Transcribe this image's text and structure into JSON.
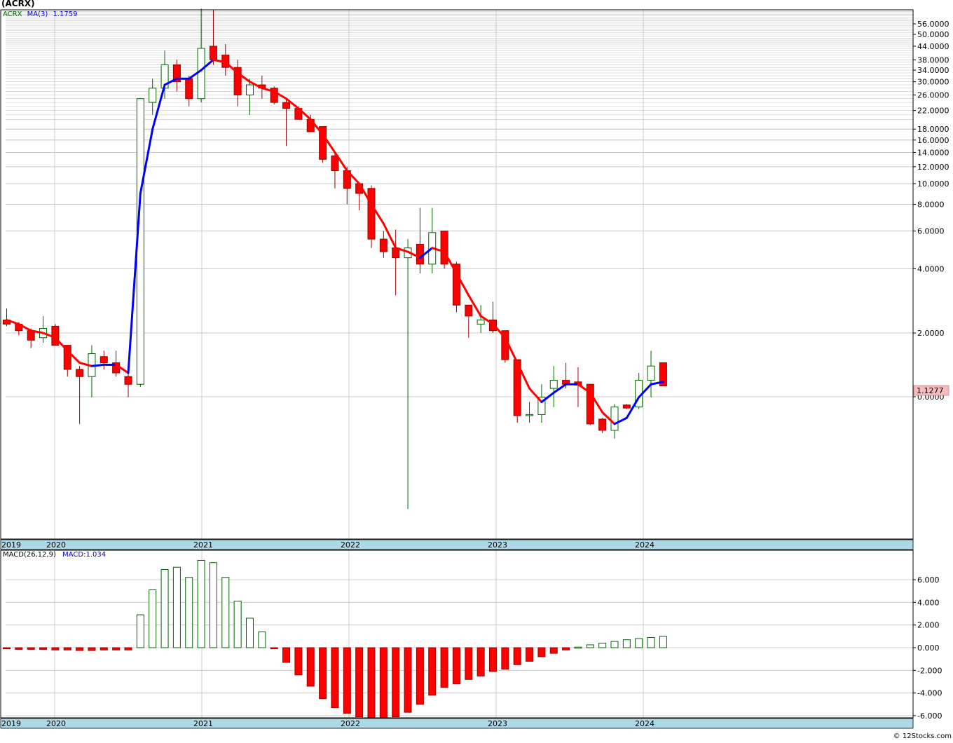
{
  "title": "(ACRX)",
  "footer": "© 12Stocks.com",
  "price_legend": {
    "symbol": "ACRX",
    "ma_label": "MA(3)",
    "ma_value": "1.1759"
  },
  "macd_legend": {
    "label": "MACD(26,12,9)",
    "value_label": "MACD:1.034"
  },
  "last_price_label": "1.1277",
  "colors": {
    "up_outline": "#006400",
    "down_fill": "#ff0000",
    "down_outline": "#990000",
    "ma_up": "#0000ff",
    "ma_down": "#ff0000",
    "grid": "#b0b0b0",
    "axis_band": "#add8e6",
    "last_price_bg": "#f4bcbc"
  },
  "chart_data": [
    {
      "type": "candlestick",
      "scale": "log",
      "y_ticks": [
        "56.0000",
        "50.0000",
        "44.0000",
        "38.0000",
        "34.0000",
        "30.0000",
        "26.0000",
        "22.0000",
        "18.0000",
        "16.0000",
        "14.0000",
        "12.0000",
        "10.0000",
        "8.0000",
        "6.0000",
        "4.0000",
        "2.0000",
        "0.0000"
      ],
      "x_labels": [
        "2019",
        "2020",
        "2021",
        "2022",
        "2023",
        "2024"
      ],
      "candles": [
        {
          "o": 2.3,
          "h": 2.6,
          "l": 2.15,
          "c": 2.2
        },
        {
          "o": 2.2,
          "h": 2.25,
          "l": 1.95,
          "c": 2.05
        },
        {
          "o": 2.05,
          "h": 2.1,
          "l": 1.7,
          "c": 1.85
        },
        {
          "o": 1.9,
          "h": 2.4,
          "l": 1.8,
          "c": 2.1
        },
        {
          "o": 2.15,
          "h": 2.2,
          "l": 1.75,
          "c": 1.75
        },
        {
          "o": 1.75,
          "h": 1.75,
          "l": 1.25,
          "c": 1.35
        },
        {
          "o": 1.35,
          "h": 1.4,
          "l": 0.75,
          "c": 1.25
        },
        {
          "o": 1.25,
          "h": 1.75,
          "l": 1.0,
          "c": 1.6
        },
        {
          "o": 1.55,
          "h": 1.65,
          "l": 1.35,
          "c": 1.45
        },
        {
          "o": 1.45,
          "h": 1.65,
          "l": 1.25,
          "c": 1.3
        },
        {
          "o": 1.25,
          "h": 1.3,
          "l": 1.0,
          "c": 1.15
        },
        {
          "o": 1.15,
          "h": 25.0,
          "l": 1.12,
          "c": 25.0
        },
        {
          "o": 24.0,
          "h": 31.0,
          "l": 21.0,
          "c": 28.0
        },
        {
          "o": 28.0,
          "h": 42.0,
          "l": 25.0,
          "c": 36.0
        },
        {
          "o": 36.0,
          "h": 38.0,
          "l": 27.0,
          "c": 30.0
        },
        {
          "o": 31.0,
          "h": 32.0,
          "l": 23.0,
          "c": 25.0
        },
        {
          "o": 25.0,
          "h": 66.0,
          "l": 24.0,
          "c": 43.0
        },
        {
          "o": 44.0,
          "h": 65.0,
          "l": 36.0,
          "c": 38.0
        },
        {
          "o": 40.0,
          "h": 45.0,
          "l": 32.0,
          "c": 35.0
        },
        {
          "o": 35.0,
          "h": 38.0,
          "l": 23.0,
          "c": 26.0
        },
        {
          "o": 26.0,
          "h": 31.0,
          "l": 21.0,
          "c": 29.0
        },
        {
          "o": 29.0,
          "h": 32.0,
          "l": 25.0,
          "c": 28.0
        },
        {
          "o": 28.0,
          "h": 28.5,
          "l": 23.5,
          "c": 24.0
        },
        {
          "o": 24.0,
          "h": 25.0,
          "l": 15.0,
          "c": 22.5
        },
        {
          "o": 22.5,
          "h": 23.0,
          "l": 20.0,
          "c": 20.0
        },
        {
          "o": 20.0,
          "h": 21.0,
          "l": 17.5,
          "c": 17.5
        },
        {
          "o": 18.5,
          "h": 18.5,
          "l": 12.5,
          "c": 13.0
        },
        {
          "o": 13.5,
          "h": 14.0,
          "l": 9.5,
          "c": 11.5
        },
        {
          "o": 11.5,
          "h": 12.0,
          "l": 8.0,
          "c": 9.5
        },
        {
          "o": 10.0,
          "h": 10.0,
          "l": 7.5,
          "c": 9.0
        },
        {
          "o": 9.5,
          "h": 9.8,
          "l": 5.0,
          "c": 5.5
        },
        {
          "o": 5.5,
          "h": 6.0,
          "l": 4.5,
          "c": 4.8
        },
        {
          "o": 5.0,
          "h": 6.1,
          "l": 3.0,
          "c": 4.5
        },
        {
          "o": 4.5,
          "h": 5.5,
          "l": 0.3,
          "c": 5.0
        },
        {
          "o": 5.2,
          "h": 7.7,
          "l": 3.8,
          "c": 4.2
        },
        {
          "o": 4.2,
          "h": 7.7,
          "l": 3.8,
          "c": 5.9
        },
        {
          "o": 6.0,
          "h": 6.0,
          "l": 4.0,
          "c": 4.2
        },
        {
          "o": 4.2,
          "h": 4.3,
          "l": 2.5,
          "c": 2.7
        },
        {
          "o": 2.7,
          "h": 2.7,
          "l": 1.9,
          "c": 2.4
        },
        {
          "o": 2.2,
          "h": 2.7,
          "l": 2.0,
          "c": 2.3
        },
        {
          "o": 2.3,
          "h": 2.8,
          "l": 2.0,
          "c": 2.05
        },
        {
          "o": 2.05,
          "h": 2.05,
          "l": 1.45,
          "c": 1.5
        },
        {
          "o": 1.5,
          "h": 1.5,
          "l": 0.76,
          "c": 0.82
        },
        {
          "o": 0.83,
          "h": 0.95,
          "l": 0.76,
          "c": 0.83
        },
        {
          "o": 0.83,
          "h": 1.15,
          "l": 0.76,
          "c": 1.0
        },
        {
          "o": 1.1,
          "h": 1.4,
          "l": 0.9,
          "c": 1.2
        },
        {
          "o": 1.2,
          "h": 1.45,
          "l": 1.1,
          "c": 1.15
        },
        {
          "o": 1.18,
          "h": 1.38,
          "l": 0.9,
          "c": 1.14
        },
        {
          "o": 1.15,
          "h": 1.15,
          "l": 0.74,
          "c": 0.75
        },
        {
          "o": 0.79,
          "h": 0.8,
          "l": 0.68,
          "c": 0.7
        },
        {
          "o": 0.7,
          "h": 0.93,
          "l": 0.64,
          "c": 0.9
        },
        {
          "o": 0.92,
          "h": 0.93,
          "l": 0.88,
          "c": 0.89
        },
        {
          "o": 0.9,
          "h": 1.3,
          "l": 0.88,
          "c": 1.2
        },
        {
          "o": 1.2,
          "h": 1.65,
          "l": 1.0,
          "c": 1.4
        },
        {
          "o": 1.45,
          "h": 1.45,
          "l": 1.15,
          "c": 1.13
        }
      ],
      "ma3": [
        2.3,
        2.2,
        2.05,
        2.0,
        1.9,
        1.65,
        1.45,
        1.4,
        1.42,
        1.42,
        1.3,
        9.0,
        18.0,
        29.0,
        31.0,
        31.0,
        34.0,
        38.0,
        37.0,
        33.0,
        30.0,
        28.0,
        27.0,
        25.0,
        22.5,
        20.0,
        17.0,
        14.0,
        11.5,
        10.0,
        8.0,
        6.5,
        5.0,
        4.8,
        4.5,
        5.0,
        4.8,
        3.8,
        3.0,
        2.4,
        2.2,
        1.9,
        1.45,
        1.1,
        0.95,
        1.05,
        1.15,
        1.15,
        1.05,
        0.85,
        0.75,
        0.8,
        1.0,
        1.15,
        1.18
      ]
    },
    {
      "type": "bar",
      "title": "MACD(26,12,9)",
      "y_ticks": [
        "6.000",
        "4.000",
        "2.000",
        "0.000",
        "-2.000",
        "-4.000",
        "-6.000"
      ],
      "x_labels": [
        "2019",
        "2020",
        "2021",
        "2022",
        "2023",
        "2024"
      ],
      "values": [
        -0.1,
        -0.15,
        -0.15,
        -0.15,
        -0.2,
        -0.2,
        -0.25,
        -0.25,
        -0.2,
        -0.2,
        -0.2,
        2.9,
        5.1,
        6.9,
        7.1,
        6.2,
        7.7,
        7.5,
        6.2,
        4.1,
        2.6,
        1.4,
        -0.1,
        -1.3,
        -2.4,
        -3.4,
        -4.5,
        -5.3,
        -5.8,
        -6.1,
        -6.2,
        -6.2,
        -6.1,
        -5.7,
        -5.0,
        -4.2,
        -3.5,
        -3.2,
        -2.8,
        -2.5,
        -2.1,
        -1.9,
        -1.5,
        -1.2,
        -0.8,
        -0.5,
        -0.2,
        0.05,
        0.25,
        0.4,
        0.55,
        0.7,
        0.8,
        0.9,
        1.0
      ]
    }
  ]
}
